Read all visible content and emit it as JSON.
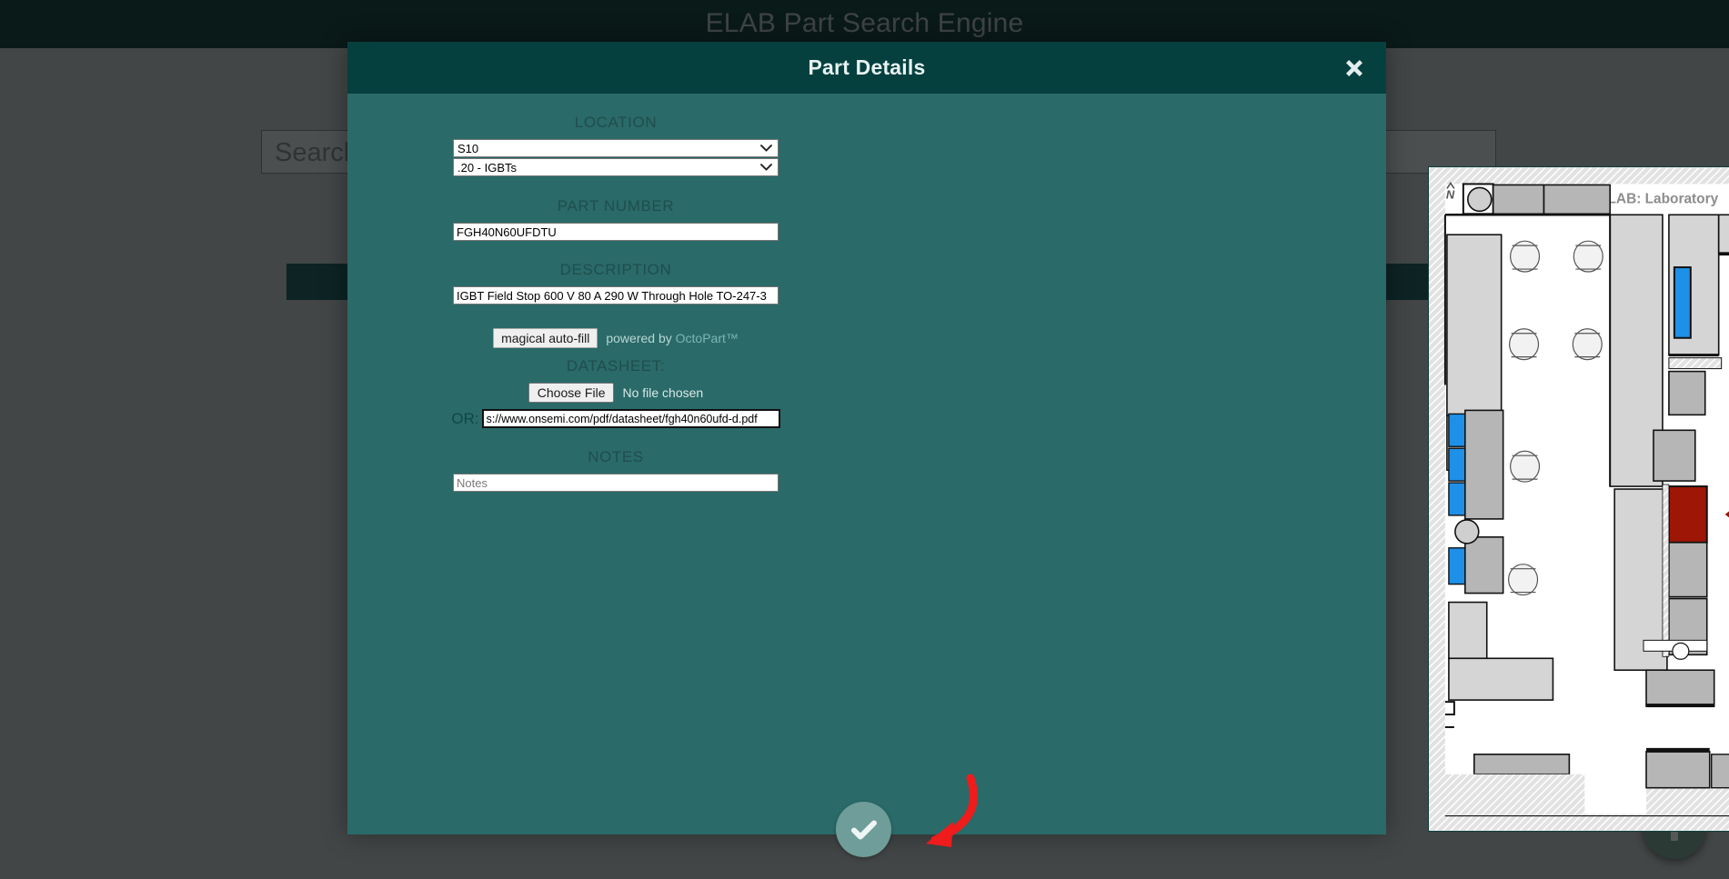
{
  "background": {
    "app_title": "ELAB Part Search Engine",
    "search_value": "Search",
    "fab_icon": "plus-icon"
  },
  "modal": {
    "title": "Part Details",
    "close_icon": "close-icon",
    "fields": {
      "location_label": "LOCATION",
      "location_room": "S10",
      "location_bin": ".20 - IGBTs",
      "part_number_label": "PART NUMBER",
      "part_number_value": "FGH40N60UFDTU",
      "description_label": "DESCRIPTION",
      "description_value": "IGBT Field Stop 600 V 80 A 290 W Through Hole TO-247-3",
      "autofill_button": "magical auto-fill",
      "powered_by_prefix": "powered by ",
      "powered_by_brand": "OctoPart™",
      "datasheet_label": "DATASHEET:",
      "choose_file_button": "Choose File",
      "file_status": "No file chosen",
      "or_label": "OR:",
      "datasheet_url_value": "s://www.onsemi.com/pdf/datasheet/fgh40n60ufd-d.pdf",
      "notes_label": "NOTES",
      "notes_value": "",
      "notes_placeholder": "Notes"
    },
    "submit": {
      "icon": "check-icon",
      "annotation_icon": "red-curved-arrow-icon"
    },
    "map": {
      "room_label": "ELAB: Laboratory",
      "north_label": "N",
      "highlight_color": "#9e1606",
      "pointer_icon": "red-left-arrow-icon",
      "marked_cabinet_color": "#1e90e8"
    }
  },
  "colors": {
    "modal_bg": "#2a6a68",
    "modal_header": "#05403f",
    "page_bg": "#424646",
    "topbar": "#0a1a18",
    "accent_red": "#ee1c1c"
  }
}
